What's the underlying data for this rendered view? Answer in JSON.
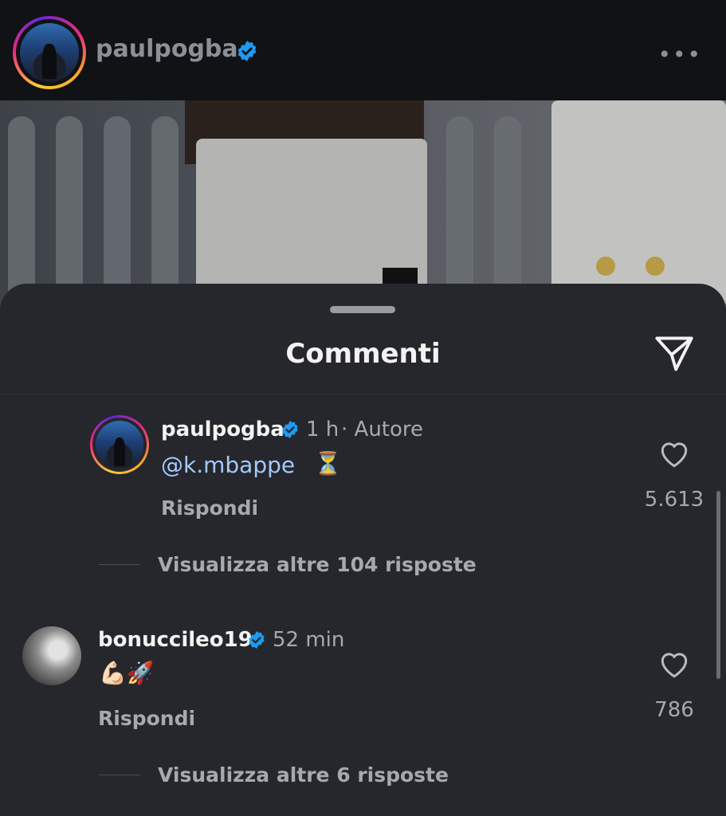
{
  "header": {
    "username": "paulpogba",
    "more_label": "•••"
  },
  "sheet": {
    "title": "Commenti"
  },
  "comments": [
    {
      "username": "paulpogba",
      "time": "1 h",
      "role": "· Autore",
      "mention": "@k.mbappe",
      "emoji": "⏳",
      "reply_label": "Rispondi",
      "likes": "5.613",
      "view_more": "Visualizza altre 104 risposte"
    },
    {
      "username": "bonuccileo19",
      "time": "52 min",
      "emoji": "💪🏻🚀",
      "reply_label": "Rispondi",
      "likes": "786",
      "view_more": "Visualizza altre 6 risposte"
    }
  ],
  "colors": {
    "verified": "#1d9bf0",
    "mention": "#a6c8ff",
    "sheet_bg": "#25272c"
  },
  "icons": [
    "verified-badge-icon",
    "more-options-icon",
    "send-icon",
    "heart-icon"
  ]
}
